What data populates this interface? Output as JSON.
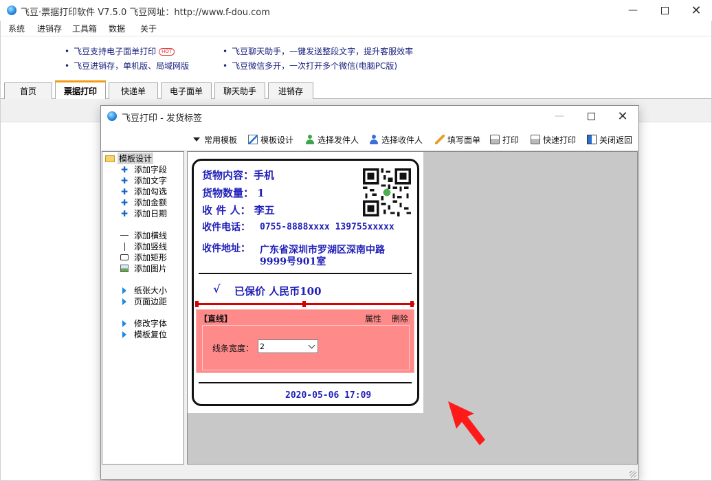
{
  "app": {
    "title": "飞豆·票据打印软件 V7.5.0   飞豆网址：http://www.f-dou.com"
  },
  "menu": [
    "系统",
    "进销存",
    "工具箱",
    "数据",
    "关于"
  ],
  "ads": {
    "left_1": "飞豆支持电子面单打印",
    "hot_badge": "HOT",
    "left_2": "飞豆进销存，单机版、局域网版",
    "right_1": "飞豆聊天助手，一键发送整段文字，提升客服效率",
    "right_2": "飞豆微信多开，一次打开多个微信(电脑PC版)"
  },
  "tabs": [
    "首页",
    "票据打印",
    "快递单",
    "电子面单",
    "聊天助手",
    "进销存"
  ],
  "active_tab": "票据打印",
  "dialog": {
    "title": "飞豆打印 - 发货标签",
    "toolbar": {
      "templates": "常用模板",
      "design": "模板设计",
      "sender": "选择发件人",
      "receiver": "选择收件人",
      "fill": "填写面单",
      "print": "打印",
      "quick_print": "快速打印",
      "close": "关闭返回"
    },
    "tree": {
      "root": "模板设计",
      "items": [
        "添加字段",
        "添加文字",
        "添加勾选",
        "添加金额",
        "添加日期",
        "添加横线",
        "添加竖线",
        "添加矩形",
        "添加图片",
        "纸张大小",
        "页面边距",
        "修改字体",
        "模板复位"
      ]
    },
    "label": {
      "goods_label": "货物内容：",
      "goods_value": "手机",
      "qty_label": "货物数量：",
      "qty_value": "1",
      "recv_label": "收 件 人：",
      "recv_value": "李五",
      "phone_label": "收件电话：",
      "phone_value": "0755-8888xxxx 139755xxxxx",
      "addr_label": "收件地址：",
      "addr_line1": "广东省深圳市罗湖区深南中路",
      "addr_line2": "9999号901室",
      "check_mark": "√",
      "insured": "已保价 人民币100",
      "date": "2020-05-06 17:09"
    },
    "prop_panel": {
      "title": "【直线】",
      "attr": "属性",
      "delete": "删除",
      "width_label": "线条宽度：",
      "width_value": "2"
    }
  },
  "colors": {
    "label_text": "#1f1fb8",
    "selection_red": "#d50000",
    "prop_panel_bg": "#ff8a8a",
    "active_tab_accent": "#f39c12"
  }
}
